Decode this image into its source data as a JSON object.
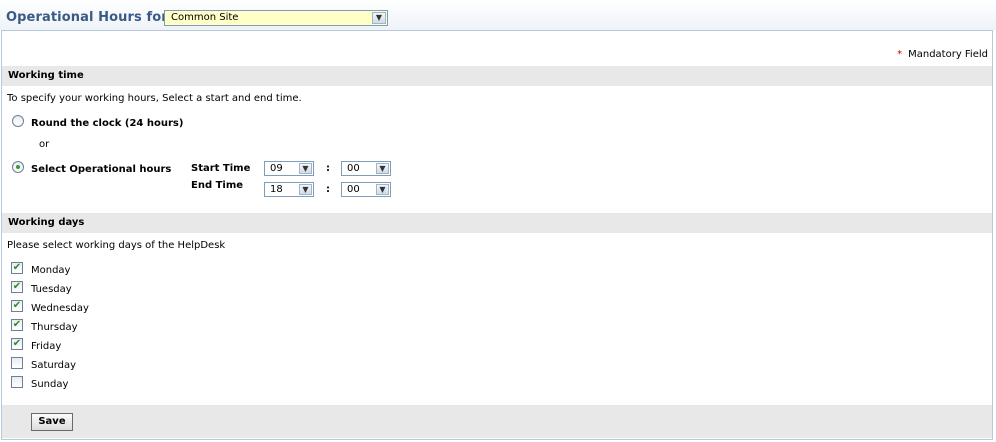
{
  "header": {
    "title": "Operational Hours for",
    "site_select": {
      "selected": "Common Site",
      "icon": "chevron-down-icon"
    }
  },
  "mandatory": {
    "star": "*",
    "label": "Mandatory Field"
  },
  "working_time": {
    "heading": "Working time",
    "instruction": "To specify your working hours, Select a start and end time.",
    "option_round_clock": "Round the clock (24 hours)",
    "or_text": "or",
    "option_select_hours": "Select Operational hours",
    "selected_option": "select_hours",
    "start_label": "Start Time",
    "end_label": "End Time",
    "separator": ":",
    "start_hour": "09",
    "start_minute": "00",
    "end_hour": "18",
    "end_minute": "00"
  },
  "working_days": {
    "heading": "Working days",
    "instruction": "Please select working days of the HelpDesk",
    "days": [
      {
        "label": "Monday",
        "checked": true
      },
      {
        "label": "Tuesday",
        "checked": true
      },
      {
        "label": "Wednesday",
        "checked": true
      },
      {
        "label": "Thursday",
        "checked": true
      },
      {
        "label": "Friday",
        "checked": true
      },
      {
        "label": "Saturday",
        "checked": false
      },
      {
        "label": "Sunday",
        "checked": false
      }
    ],
    "check_mark": "✔"
  },
  "footer": {
    "save_label": "Save"
  }
}
